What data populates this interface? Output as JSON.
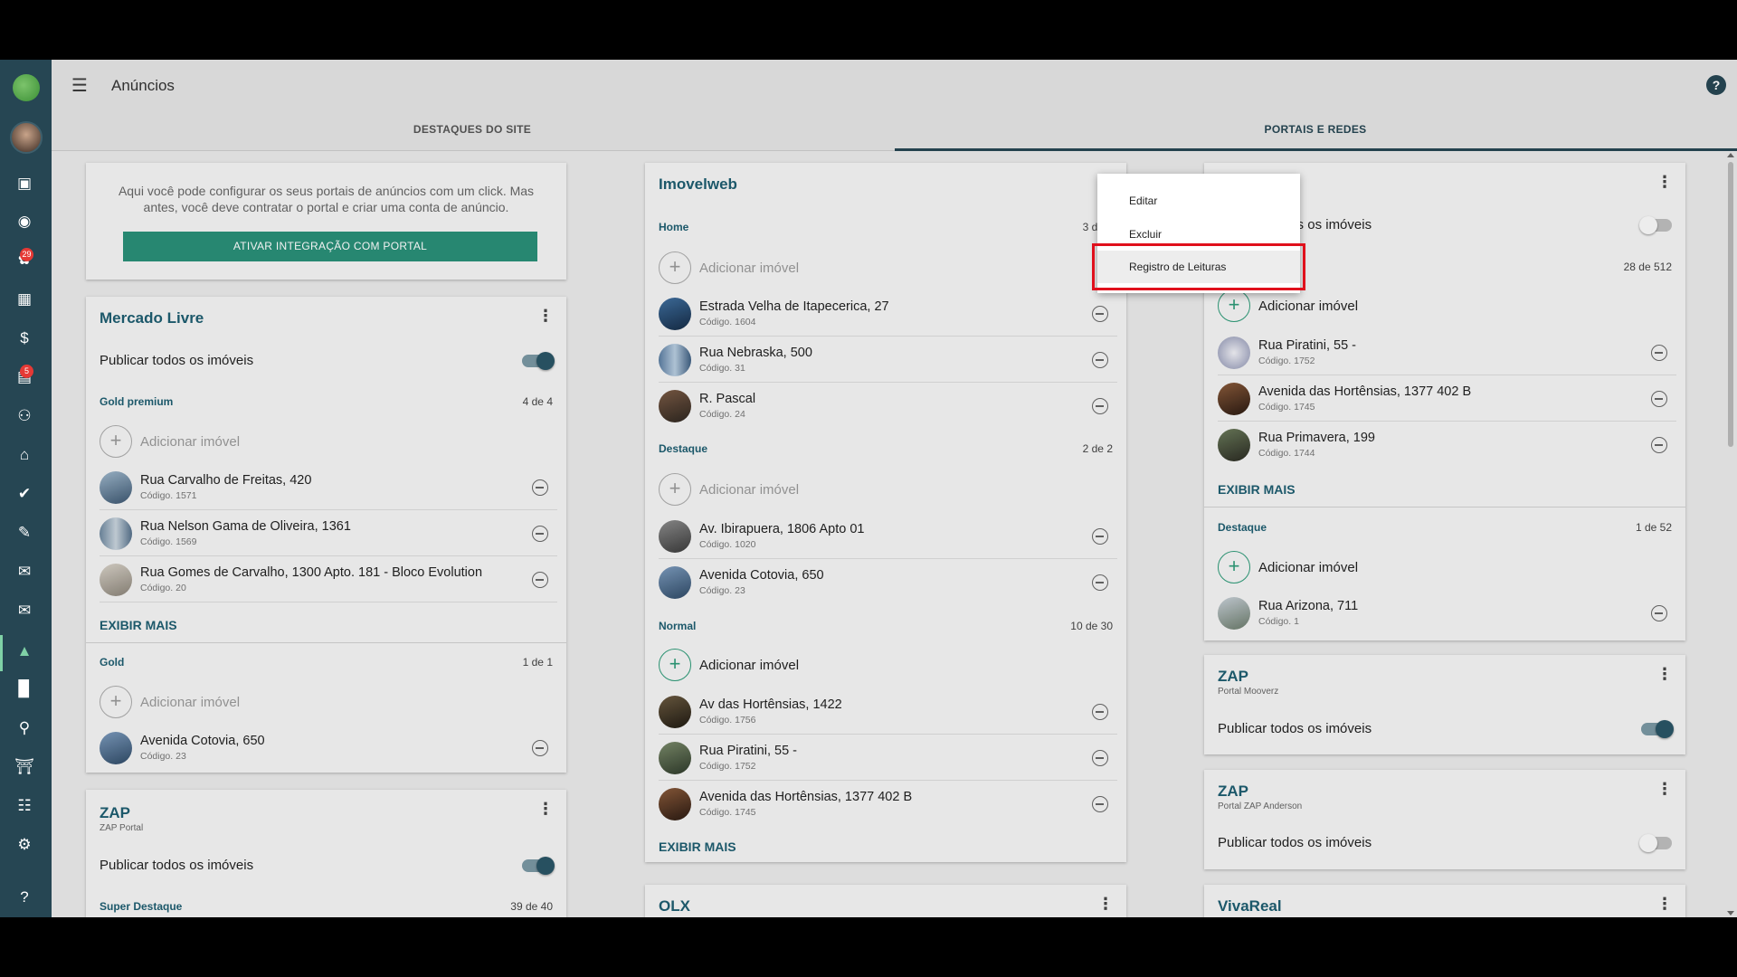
{
  "app": {
    "page_title": "Anúncios"
  },
  "sidebar": {
    "badges": {
      "notifications_fire": "29",
      "leads": "5"
    }
  },
  "tabs": [
    {
      "label": "DESTAQUES DO SITE",
      "active": false
    },
    {
      "label": "PORTAIS E REDES",
      "active": true
    }
  ],
  "info_card": {
    "text": "Aqui você pode configurar os seus portais de anúncios com um click. Mas antes, você deve contratar o portal e criar uma conta de anúncio.",
    "button": "ATIVAR INTEGRAÇÃO COM PORTAL"
  },
  "publish_all_label": "Publicar todos os imóveis",
  "add_property_label": "Adicionar imóvel",
  "show_more_label": "EXIBIR MAIS",
  "mercado_livre": {
    "title": "Mercado Livre",
    "publish_all": true,
    "gold_premium": {
      "name": "Gold premium",
      "count": "4 de 4",
      "items": [
        {
          "name": "Rua Carvalho de Freitas, 420",
          "code": "Código. 1571"
        },
        {
          "name": "Rua Nelson Gama de Oliveira, 1361",
          "code": "Código. 1569"
        },
        {
          "name": "Rua Gomes de Carvalho, 1300 Apto. 181 - Bloco Evolution",
          "code": "Código. 20"
        }
      ]
    },
    "gold": {
      "name": "Gold",
      "count": "1 de 1",
      "items": [
        {
          "name": "Avenida Cotovia, 650",
          "code": "Código. 23"
        }
      ]
    }
  },
  "zap_left": {
    "title": "ZAP",
    "subtitle": "ZAP Portal",
    "publish_all": true,
    "section": {
      "name": "Super Destaque",
      "count": "39 de 40"
    }
  },
  "imovelweb": {
    "title": "Imovelweb",
    "home": {
      "name": "Home",
      "count": "3 de 3",
      "items": [
        {
          "name": "Estrada Velha de Itapecerica, 27",
          "code": "Código. 1604"
        },
        {
          "name": "Rua Nebraska, 500",
          "code": "Código. 31"
        },
        {
          "name": "R. Pascal",
          "code": "Código. 24"
        }
      ]
    },
    "destaque": {
      "name": "Destaque",
      "count": "2 de 2",
      "items": [
        {
          "name": "Av. Ibirapuera, 1806 Apto 01",
          "code": "Código. 1020"
        },
        {
          "name": "Avenida Cotovia, 650",
          "code": "Código. 23"
        }
      ]
    },
    "normal": {
      "name": "Normal",
      "count": "10 de 30",
      "items": [
        {
          "name": "Av das Hortênsias, 1422",
          "code": "Código. 1756"
        },
        {
          "name": "Rua Piratini, 55 -",
          "code": "Código. 1752"
        },
        {
          "name": "Avenida das Hortênsias, 1377 402 B",
          "code": "Código. 1745"
        }
      ]
    }
  },
  "olx": {
    "title": "OLX"
  },
  "right_card": {
    "publish_all": false,
    "section1": {
      "count": "28 de 512",
      "items": [
        {
          "name": "Rua Piratini, 55 -",
          "code": "Código. 1752"
        },
        {
          "name": "Avenida das Hortênsias, 1377 402 B",
          "code": "Código. 1745"
        },
        {
          "name": "Rua Primavera, 199",
          "code": "Código. 1744"
        }
      ]
    },
    "destaque": {
      "name": "Destaque",
      "count": "1 de 52",
      "items": [
        {
          "name": "Rua Arizona, 711",
          "code": "Código. 1"
        }
      ]
    }
  },
  "zap_mooverz": {
    "title": "ZAP",
    "subtitle": "Portal Mooverz",
    "publish_all": true
  },
  "zap_anderson": {
    "title": "ZAP",
    "subtitle": "Portal ZAP Anderson",
    "publish_all": false
  },
  "vivareal": {
    "title": "VivaReal"
  },
  "context_menu": {
    "items": [
      "Editar",
      "Excluir",
      "Registro de Leituras"
    ],
    "hovered": "Registro de Leituras"
  },
  "colors": {
    "sidebar": "#264653",
    "accent": "#2a8f78",
    "title": "#1e5d70",
    "highlight": "#e0101c"
  }
}
